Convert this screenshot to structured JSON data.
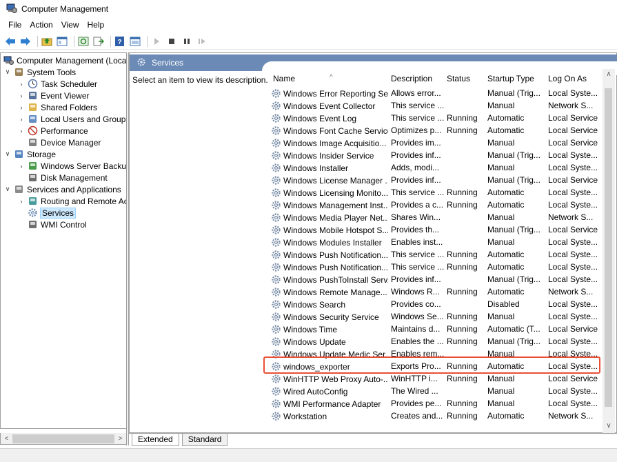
{
  "window": {
    "title": "Computer Management"
  },
  "menu": [
    "File",
    "Action",
    "View",
    "Help"
  ],
  "tree": {
    "root": "Computer Management (Local",
    "items": [
      {
        "label": "System Tools",
        "indent": 1,
        "arrow": "v",
        "icon": "tools-icon"
      },
      {
        "label": "Task Scheduler",
        "indent": 2,
        "arrow": ">",
        "icon": "clock-icon"
      },
      {
        "label": "Event Viewer",
        "indent": 2,
        "arrow": ">",
        "icon": "event-viewer-icon"
      },
      {
        "label": "Shared Folders",
        "indent": 2,
        "arrow": ">",
        "icon": "shared-folder-icon"
      },
      {
        "label": "Local Users and Groups",
        "indent": 2,
        "arrow": ">",
        "icon": "users-icon"
      },
      {
        "label": "Performance",
        "indent": 2,
        "arrow": ">",
        "icon": "performance-icon"
      },
      {
        "label": "Device Manager",
        "indent": 2,
        "arrow": "",
        "icon": "device-manager-icon"
      },
      {
        "label": "Storage",
        "indent": 1,
        "arrow": "v",
        "icon": "storage-icon"
      },
      {
        "label": "Windows Server Backup",
        "indent": 2,
        "arrow": ">",
        "icon": "backup-icon"
      },
      {
        "label": "Disk Management",
        "indent": 2,
        "arrow": "",
        "icon": "disk-icon"
      },
      {
        "label": "Services and Applications",
        "indent": 1,
        "arrow": "v",
        "icon": "services-apps-icon"
      },
      {
        "label": "Routing and Remote Ac",
        "indent": 2,
        "arrow": ">",
        "icon": "routing-icon"
      },
      {
        "label": "Services",
        "indent": 2,
        "arrow": "",
        "icon": "gear-icon",
        "selected": true
      },
      {
        "label": "WMI Control",
        "indent": 2,
        "arrow": "",
        "icon": "wmi-icon"
      }
    ]
  },
  "main": {
    "header": "Services",
    "description_hint": "Select an item to view its description.",
    "columns": [
      "Name",
      "Description",
      "Status",
      "Startup Type",
      "Log On As"
    ],
    "rows": [
      [
        "Windows Error Reporting Se...",
        "Allows error...",
        "",
        "Manual (Trig...",
        "Local Syste..."
      ],
      [
        "Windows Event Collector",
        "This service ...",
        "",
        "Manual",
        "Network S..."
      ],
      [
        "Windows Event Log",
        "This service ...",
        "Running",
        "Automatic",
        "Local Service"
      ],
      [
        "Windows Font Cache Service",
        "Optimizes p...",
        "Running",
        "Automatic",
        "Local Service"
      ],
      [
        "Windows Image Acquisitio...",
        "Provides im...",
        "",
        "Manual",
        "Local Service"
      ],
      [
        "Windows Insider Service",
        "Provides inf...",
        "",
        "Manual (Trig...",
        "Local Syste..."
      ],
      [
        "Windows Installer",
        "Adds, modi...",
        "",
        "Manual",
        "Local Syste..."
      ],
      [
        "Windows License Manager ...",
        "Provides inf...",
        "",
        "Manual (Trig...",
        "Local Service"
      ],
      [
        "Windows Licensing Monito...",
        "This service ...",
        "Running",
        "Automatic",
        "Local Syste..."
      ],
      [
        "Windows Management Inst...",
        "Provides a c...",
        "Running",
        "Automatic",
        "Local Syste..."
      ],
      [
        "Windows Media Player Net...",
        "Shares Win...",
        "",
        "Manual",
        "Network S..."
      ],
      [
        "Windows Mobile Hotspot S...",
        "Provides th...",
        "",
        "Manual (Trig...",
        "Local Service"
      ],
      [
        "Windows Modules Installer",
        "Enables inst...",
        "",
        "Manual",
        "Local Syste..."
      ],
      [
        "Windows Push Notification...",
        "This service ...",
        "Running",
        "Automatic",
        "Local Syste..."
      ],
      [
        "Windows Push Notification...",
        "This service ...",
        "Running",
        "Automatic",
        "Local Syste..."
      ],
      [
        "Windows PushToInstall Serv...",
        "Provides inf...",
        "",
        "Manual (Trig...",
        "Local Syste..."
      ],
      [
        "Windows Remote Manage...",
        "Windows R...",
        "Running",
        "Automatic",
        "Network S..."
      ],
      [
        "Windows Search",
        "Provides co...",
        "",
        "Disabled",
        "Local Syste..."
      ],
      [
        "Windows Security Service",
        "Windows Se...",
        "Running",
        "Manual",
        "Local Syste..."
      ],
      [
        "Windows Time",
        "Maintains d...",
        "Running",
        "Automatic (T...",
        "Local Service"
      ],
      [
        "Windows Update",
        "Enables the ...",
        "Running",
        "Manual (Trig...",
        "Local Syste..."
      ],
      [
        "Windows Update Medic Ser...",
        "Enables rem...",
        "",
        "Manual",
        "Local Syste..."
      ],
      [
        "windows_exporter",
        "Exports Pro...",
        "Running",
        "Automatic",
        "Local Syste..."
      ],
      [
        "WinHTTP Web Proxy Auto-...",
        "WinHTTP i...",
        "Running",
        "Manual",
        "Local Service"
      ],
      [
        "Wired AutoConfig",
        "The Wired ...",
        "",
        "Manual",
        "Local Syste..."
      ],
      [
        "WMI Performance Adapter",
        "Provides pe...",
        "Running",
        "Manual",
        "Local Syste..."
      ],
      [
        "Workstation",
        "Creates and...",
        "Running",
        "Automatic",
        "Network S..."
      ]
    ],
    "highlight_color": "#e94f35"
  },
  "tabs": [
    "Extended",
    "Standard"
  ]
}
